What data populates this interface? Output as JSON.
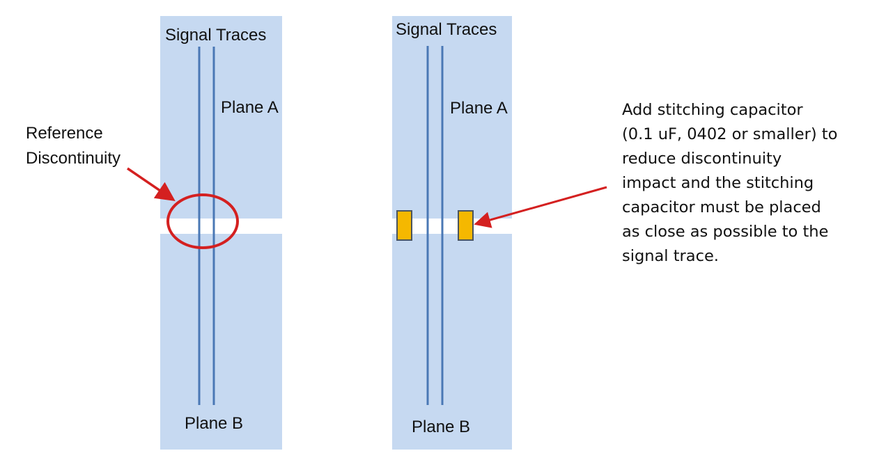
{
  "colors": {
    "plane_fill": "#c6d9f1",
    "trace": "#4a78b5",
    "callout": "#d42020",
    "capacitor_fill": "#f5b800",
    "capacitor_stroke": "#4a5560",
    "text": "#111111"
  },
  "left_panel": {
    "top_label": "Signal Traces",
    "plane_a_label": "Plane A",
    "plane_b_label": "Plane B"
  },
  "right_panel": {
    "top_label": "Signal Traces",
    "plane_a_label": "Plane A",
    "plane_b_label": "Plane B"
  },
  "reference_callout": {
    "lines": [
      "Reference",
      "Discontinuity"
    ]
  },
  "stitching_note": {
    "lines": [
      "Add stitching capacitor",
      "(0.1 uF, 0402 or smaller) to",
      "reduce discontinuity",
      "impact and the stitching",
      "capacitor must be placed",
      "as close as possible to the",
      "signal trace."
    ]
  }
}
